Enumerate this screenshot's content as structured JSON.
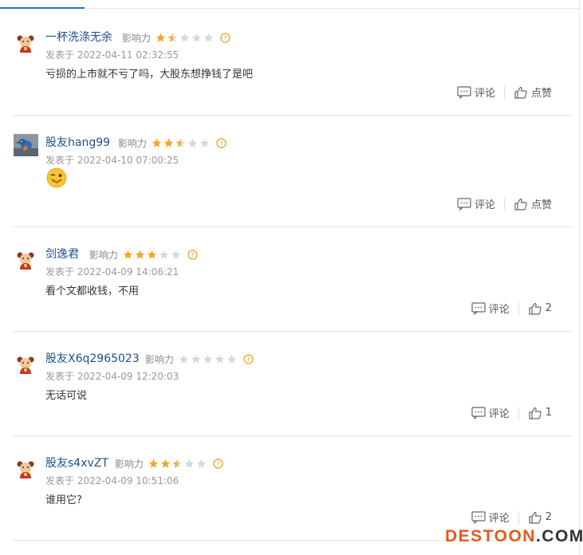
{
  "labels": {
    "influence": "影响力",
    "reply": "评论",
    "like": "点赞"
  },
  "colors": {
    "star_on": "#f5a623",
    "star_off": "#d8d8d8",
    "link": "#1d4f91",
    "accent_tab": "#2a6fc9"
  },
  "comments": [
    {
      "user": "一杯洗涤无余",
      "rating": 1.5,
      "time": "发表于 2022-04-11 02:32:55",
      "text": "亏损的上市就不亏了吗，大股东想挣钱了是吧",
      "like_label": "点赞"
    },
    {
      "user": "股友hang99",
      "rating": 2.5,
      "time": "发表于 2022-04-10 07:00:25",
      "text": "",
      "emoji": "wink-tongue-emoji",
      "like_label": "点赞"
    },
    {
      "user": "剑逸君",
      "rating": 3,
      "time": "发表于 2022-04-09 14:06:21",
      "text": "看个文都收钱，不用",
      "like_label": "2"
    },
    {
      "user": "股友X6q2965023",
      "rating": 0,
      "time": "发表于 2022-04-09 12:20:03",
      "text": "无话可说",
      "like_label": "1"
    },
    {
      "user": "股友s4xvZT",
      "rating": 2.5,
      "time": "发表于 2022-04-09 10:51:06",
      "text": "谁用它?",
      "like_label": "2"
    }
  ],
  "watermark": {
    "part1": "DESTOON",
    "part2": ".COM"
  }
}
